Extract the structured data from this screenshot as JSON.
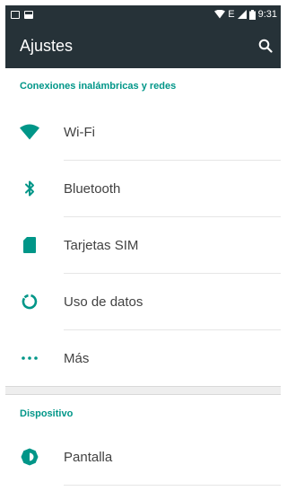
{
  "status_bar": {
    "left_icons": [
      "notification-icon",
      "image-notification-icon"
    ],
    "right_icons": [
      "wifi-signal-icon",
      "mobile-signal-icon",
      "battery-icon"
    ],
    "network_label": "E",
    "time": "9:31"
  },
  "toolbar": {
    "title": "Ajustes",
    "search_icon": "search-icon"
  },
  "sections": [
    {
      "header": "Conexiones inalámbricas y redes",
      "items": [
        {
          "label": "Wi-Fi",
          "icon": "wifi-icon"
        },
        {
          "label": "Bluetooth",
          "icon": "bluetooth-icon"
        },
        {
          "label": "Tarjetas SIM",
          "icon": "sim-card-icon"
        },
        {
          "label": "Uso de datos",
          "icon": "data-usage-icon"
        },
        {
          "label": "Más",
          "icon": "more-icon"
        }
      ]
    },
    {
      "header": "Dispositivo",
      "items": [
        {
          "label": "Pantalla",
          "icon": "brightness-icon"
        }
      ]
    }
  ],
  "colors": {
    "toolbar": "#263238",
    "accent": "#009688",
    "text": "#424242"
  }
}
